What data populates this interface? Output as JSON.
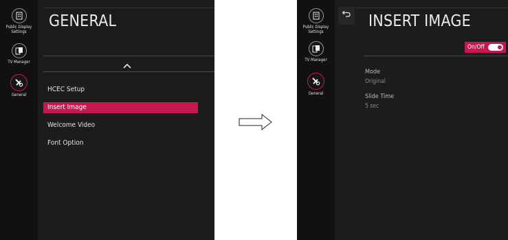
{
  "left_screen": {
    "rail": {
      "items": [
        {
          "label_line1": "Public Display",
          "label_line2": "Settings",
          "icon": "building-icon"
        },
        {
          "label_line1": "TV Manager",
          "label_line2": "",
          "icon": "tv-manager-icon"
        },
        {
          "label_line1": "General",
          "label_line2": "",
          "icon": "general-settings-icon",
          "active": true
        }
      ]
    },
    "title": "GENERAL",
    "menu": [
      {
        "label": "HCEC Setup",
        "selected": false
      },
      {
        "label": "Insert Image",
        "selected": true
      },
      {
        "label": "Welcome Video",
        "selected": false
      },
      {
        "label": "Font Option",
        "selected": false
      }
    ]
  },
  "right_screen": {
    "rail": {
      "items": [
        {
          "label_line1": "Public Display",
          "label_line2": "Settings",
          "icon": "building-icon"
        },
        {
          "label_line1": "TV Manager",
          "label_line2": "",
          "icon": "tv-manager-icon"
        },
        {
          "label_line1": "General",
          "label_line2": "",
          "icon": "general-settings-icon",
          "active": true
        }
      ]
    },
    "title": "INSERT IMAGE",
    "toggle": {
      "label": "On/Off",
      "state": "on"
    },
    "settings": [
      {
        "label": "Mode",
        "value": "Original"
      },
      {
        "label": "Slide Time",
        "value": "5 sec"
      }
    ]
  },
  "colors": {
    "accent": "#c8174f",
    "background": "#1c1c1c",
    "rail": "#111111"
  }
}
